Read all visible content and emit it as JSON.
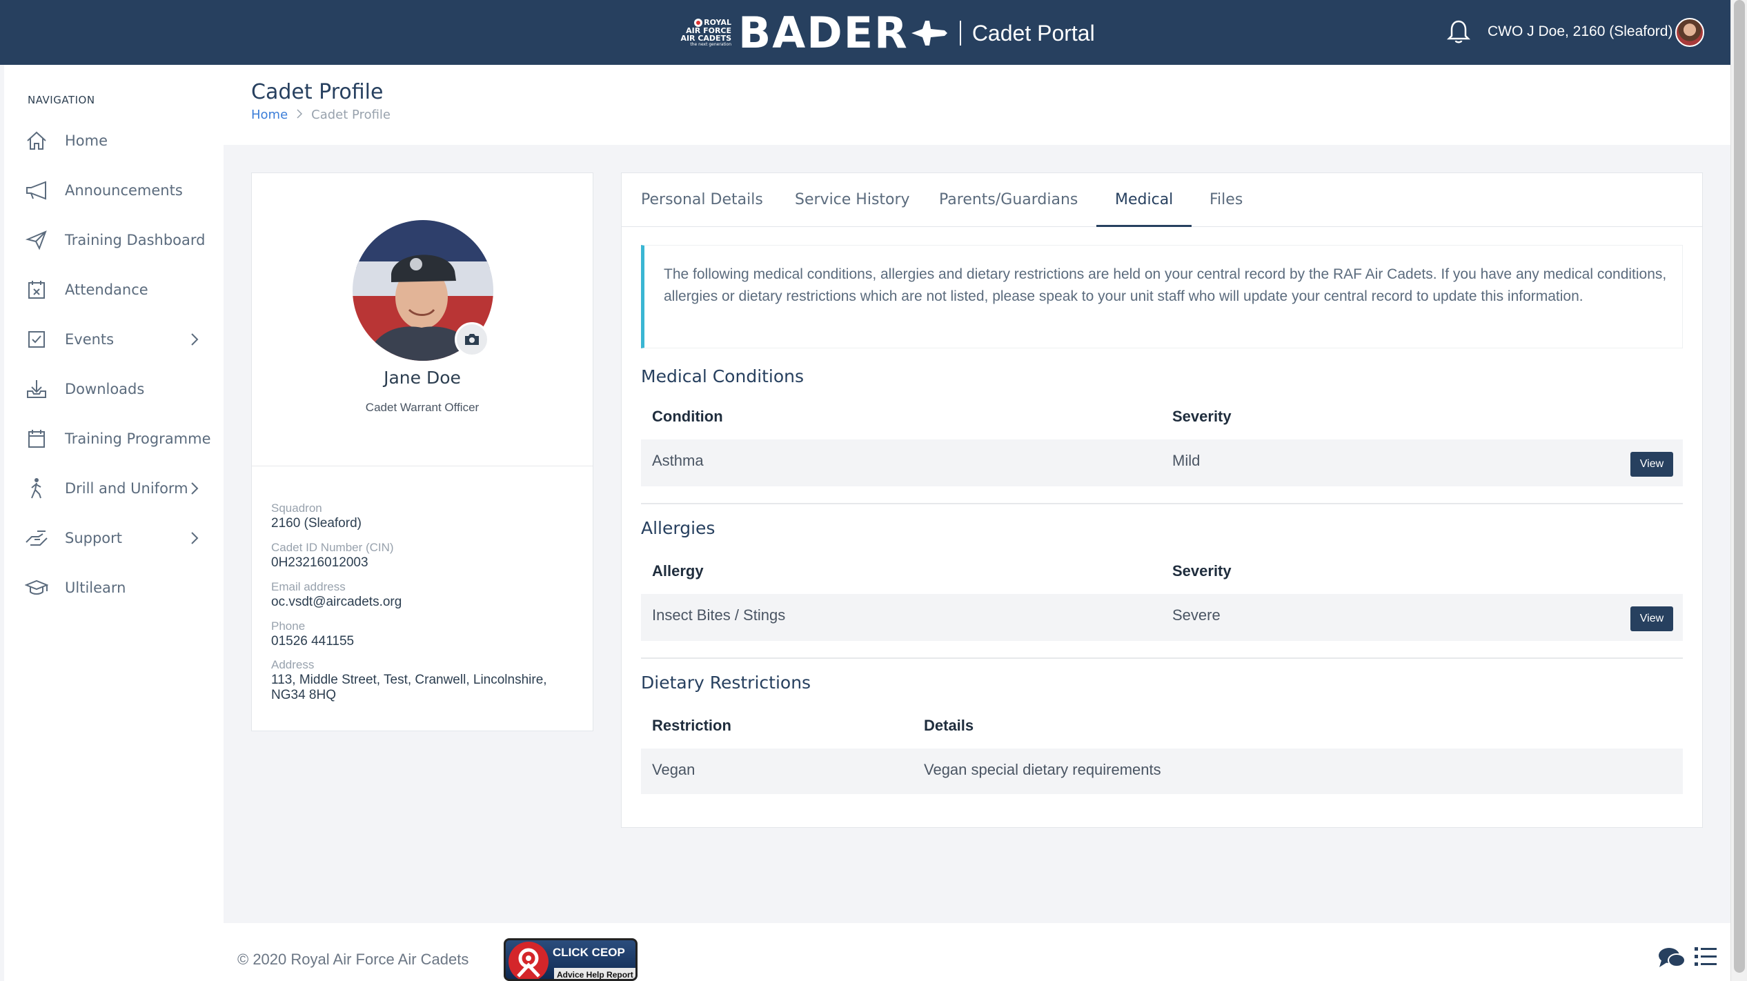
{
  "header": {
    "raf_lines": [
      "ROYAL",
      "AIR FORCE",
      "AIR CADETS"
    ],
    "raf_tagline": "the next generation",
    "brand": "BADER",
    "portal": "Cadet Portal",
    "user": "CWO J Doe, 2160 (Sleaford)"
  },
  "sidebar": {
    "title": "NAVIGATION",
    "items": [
      {
        "label": "Home",
        "icon": "home-icon"
      },
      {
        "label": "Announcements",
        "icon": "megaphone-icon"
      },
      {
        "label": "Training Dashboard",
        "icon": "paper-plane-icon"
      },
      {
        "label": "Attendance",
        "icon": "calendar-x-icon"
      },
      {
        "label": "Events",
        "icon": "checkbox-icon",
        "has_children": true
      },
      {
        "label": "Downloads",
        "icon": "download-tray-icon"
      },
      {
        "label": "Training Programme",
        "icon": "calendar-icon"
      },
      {
        "label": "Drill and Uniform",
        "icon": "walking-person-icon",
        "has_children": true
      },
      {
        "label": "Support",
        "icon": "support-hand-icon",
        "has_children": true
      },
      {
        "label": "Ultilearn",
        "icon": "graduation-cap-icon"
      }
    ]
  },
  "page": {
    "title": "Cadet Profile",
    "breadcrumb_home": "Home",
    "breadcrumb_current": "Cadet Profile"
  },
  "profile": {
    "name": "Jane Doe",
    "rank": "Cadet Warrant Officer",
    "fields": [
      {
        "label": "Squadron",
        "value": "2160 (Sleaford)"
      },
      {
        "label": "Cadet ID Number (CIN)",
        "value": "0H23216012003"
      },
      {
        "label": "Email address",
        "value": "oc.vsdt@aircadets.org"
      },
      {
        "label": "Phone",
        "value": "01526 441155"
      },
      {
        "label": "Address",
        "value": "113, Middle Street, Test, Cranwell, Lincolnshire, NG34 8HQ"
      }
    ]
  },
  "tabs": [
    "Personal Details",
    "Service History",
    "Parents/Guardians",
    "Medical",
    "Files"
  ],
  "active_tab": "Medical",
  "medical": {
    "info": "The following medical conditions, allergies and dietary restrictions are held on your central record by the RAF Air Cadets. If you have any medical conditions, allergies or dietary restrictions which are not listed, please speak to your unit staff who will update your central record to update this information.",
    "conditions": {
      "title": "Medical Conditions",
      "col1": "Condition",
      "col2": "Severity",
      "rows": [
        {
          "name": "Asthma",
          "severity": "Mild",
          "action": "View"
        }
      ]
    },
    "allergies": {
      "title": "Allergies",
      "col1": "Allergy",
      "col2": "Severity",
      "rows": [
        {
          "name": "Insect Bites / Stings",
          "severity": "Severe",
          "action": "View"
        }
      ]
    },
    "dietary": {
      "title": "Dietary Restrictions",
      "col1": "Restriction",
      "col2": "Details",
      "rows": [
        {
          "name": "Vegan",
          "details": "Vegan special dietary requirements"
        }
      ]
    }
  },
  "footer": {
    "copyright": "© 2020 Royal Air Force Air Cadets",
    "ceop_title": "CLICK CEOP",
    "ceop_sub": "Advice Help Report"
  },
  "colors": {
    "navy": "#27405f",
    "accent_cyan": "#3ab6d3",
    "link_blue": "#3b7dd8"
  }
}
